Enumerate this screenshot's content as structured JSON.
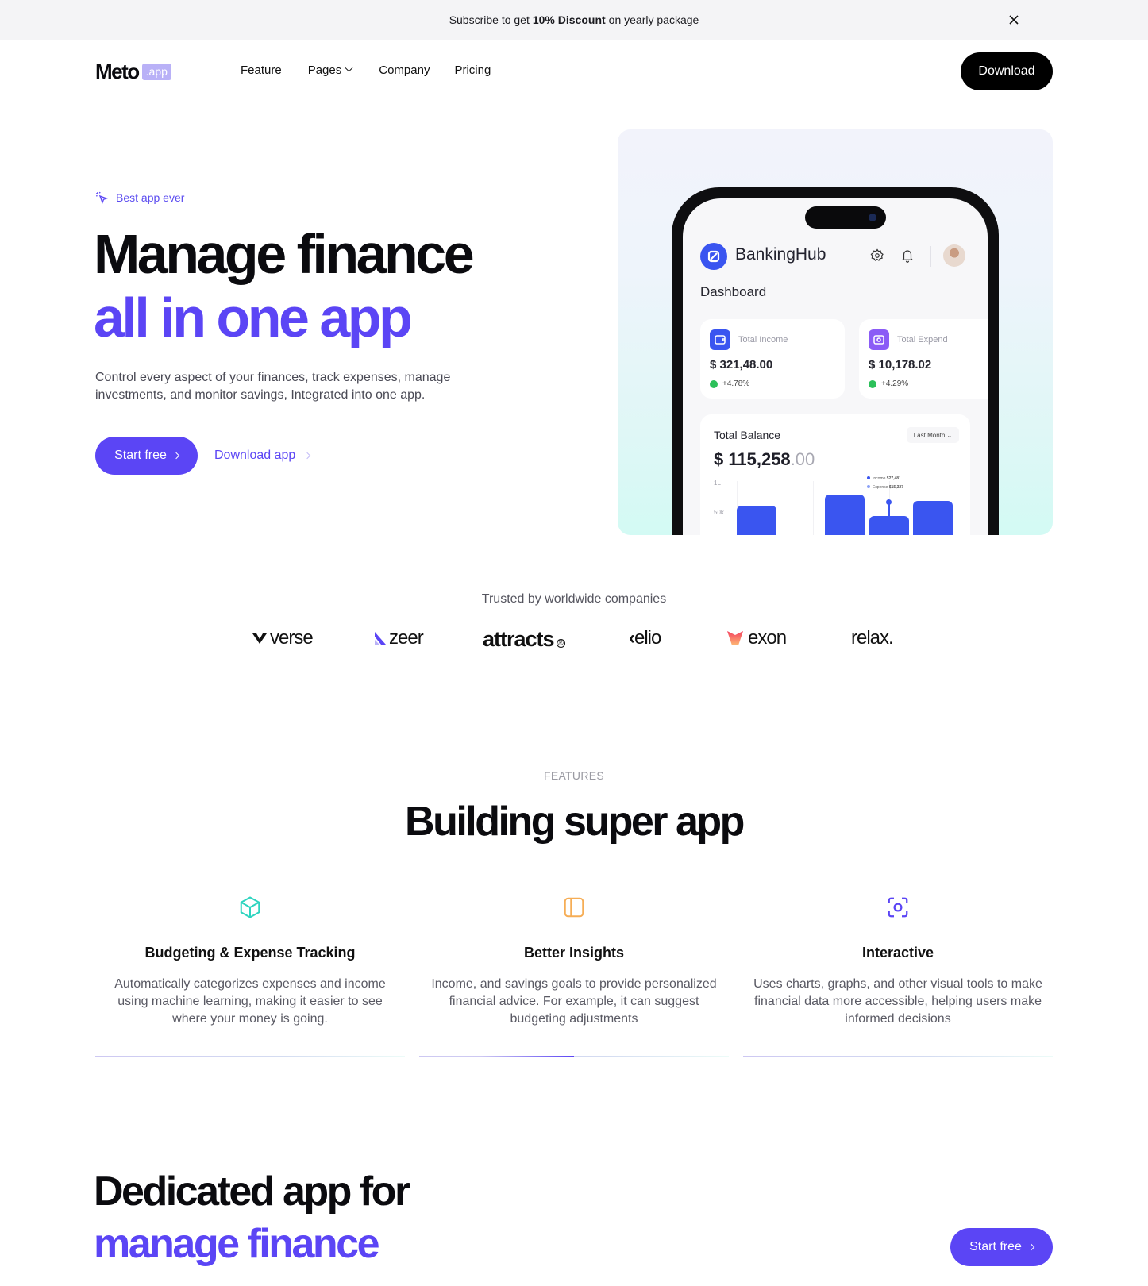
{
  "banner": {
    "text_before": "Subscribe to get",
    "text_bold": "10% Discount",
    "text_after": "on yearly package",
    "close_icon": "close-icon"
  },
  "nav": {
    "logo_text": "Meto",
    "logo_badge": ".app",
    "links": [
      {
        "label": "Feature"
      },
      {
        "label": "Pages",
        "has_dropdown": true
      },
      {
        "label": "Company"
      },
      {
        "label": "Pricing"
      }
    ],
    "download_label": "Download"
  },
  "hero": {
    "tag": "Best app ever",
    "title_line1": "Manage finance",
    "title_line2": "all in one app",
    "description": "Control every aspect of your finances, track expenses, manage investments, and monitor savings, Integrated into one app.",
    "primary_cta": "Start free",
    "secondary_cta": "Download app"
  },
  "phone": {
    "app_name": "BankingHub",
    "screen_title": "Dashboard",
    "cards": [
      {
        "label": "Total Income",
        "value": "$ 321,48.00",
        "change": "+4.78%",
        "color": "#3a55f0"
      },
      {
        "label": "Total Expend",
        "value": "$ 10,178.02",
        "change": "+4.29%",
        "color": "#8b5cf6"
      }
    ],
    "balance": {
      "title": "Total Balance",
      "period": "Last Month",
      "amount_main": "$ 115,258",
      "amount_decimal": ".00",
      "y_ticks": [
        "1L",
        "50k"
      ],
      "tooltip": [
        {
          "label": "Income",
          "value": "$27,481"
        },
        {
          "label": "Expense",
          "value": "$15,327"
        }
      ]
    }
  },
  "trusted": {
    "heading": "Trusted by worldwide companies",
    "brands": [
      "verse",
      "zeer",
      "attracts",
      "elio",
      "exon",
      "relax."
    ]
  },
  "features": {
    "kicker": "FEATURES",
    "title": "Building super app",
    "active_index": 1,
    "active_progress": 0.5,
    "items": [
      {
        "icon": "cube-icon",
        "title": "Budgeting & Expense Tracking",
        "description": "Automatically categorizes expenses and income using machine learning, making it easier to see where your money is going.",
        "color": "#2dd4bf"
      },
      {
        "icon": "sidebar-panel-icon",
        "title": "Better Insights",
        "description": "Income, and savings goals to provide personalized financial advice. For example, it can suggest budgeting adjustments",
        "color": "#f6ad55"
      },
      {
        "icon": "scan-focus-icon",
        "title": "Interactive",
        "description": "Uses charts, graphs, and other visual tools to make financial data more accessible, helping users make informed decisions",
        "color": "#5b45f5"
      }
    ]
  },
  "cta": {
    "title_line1": "Dedicated app for",
    "title_line2": "manage finance",
    "button": "Start free"
  },
  "colors": {
    "accent": "#5b45f5",
    "dark": "#000000",
    "banner_bg": "#f4f4f6"
  }
}
